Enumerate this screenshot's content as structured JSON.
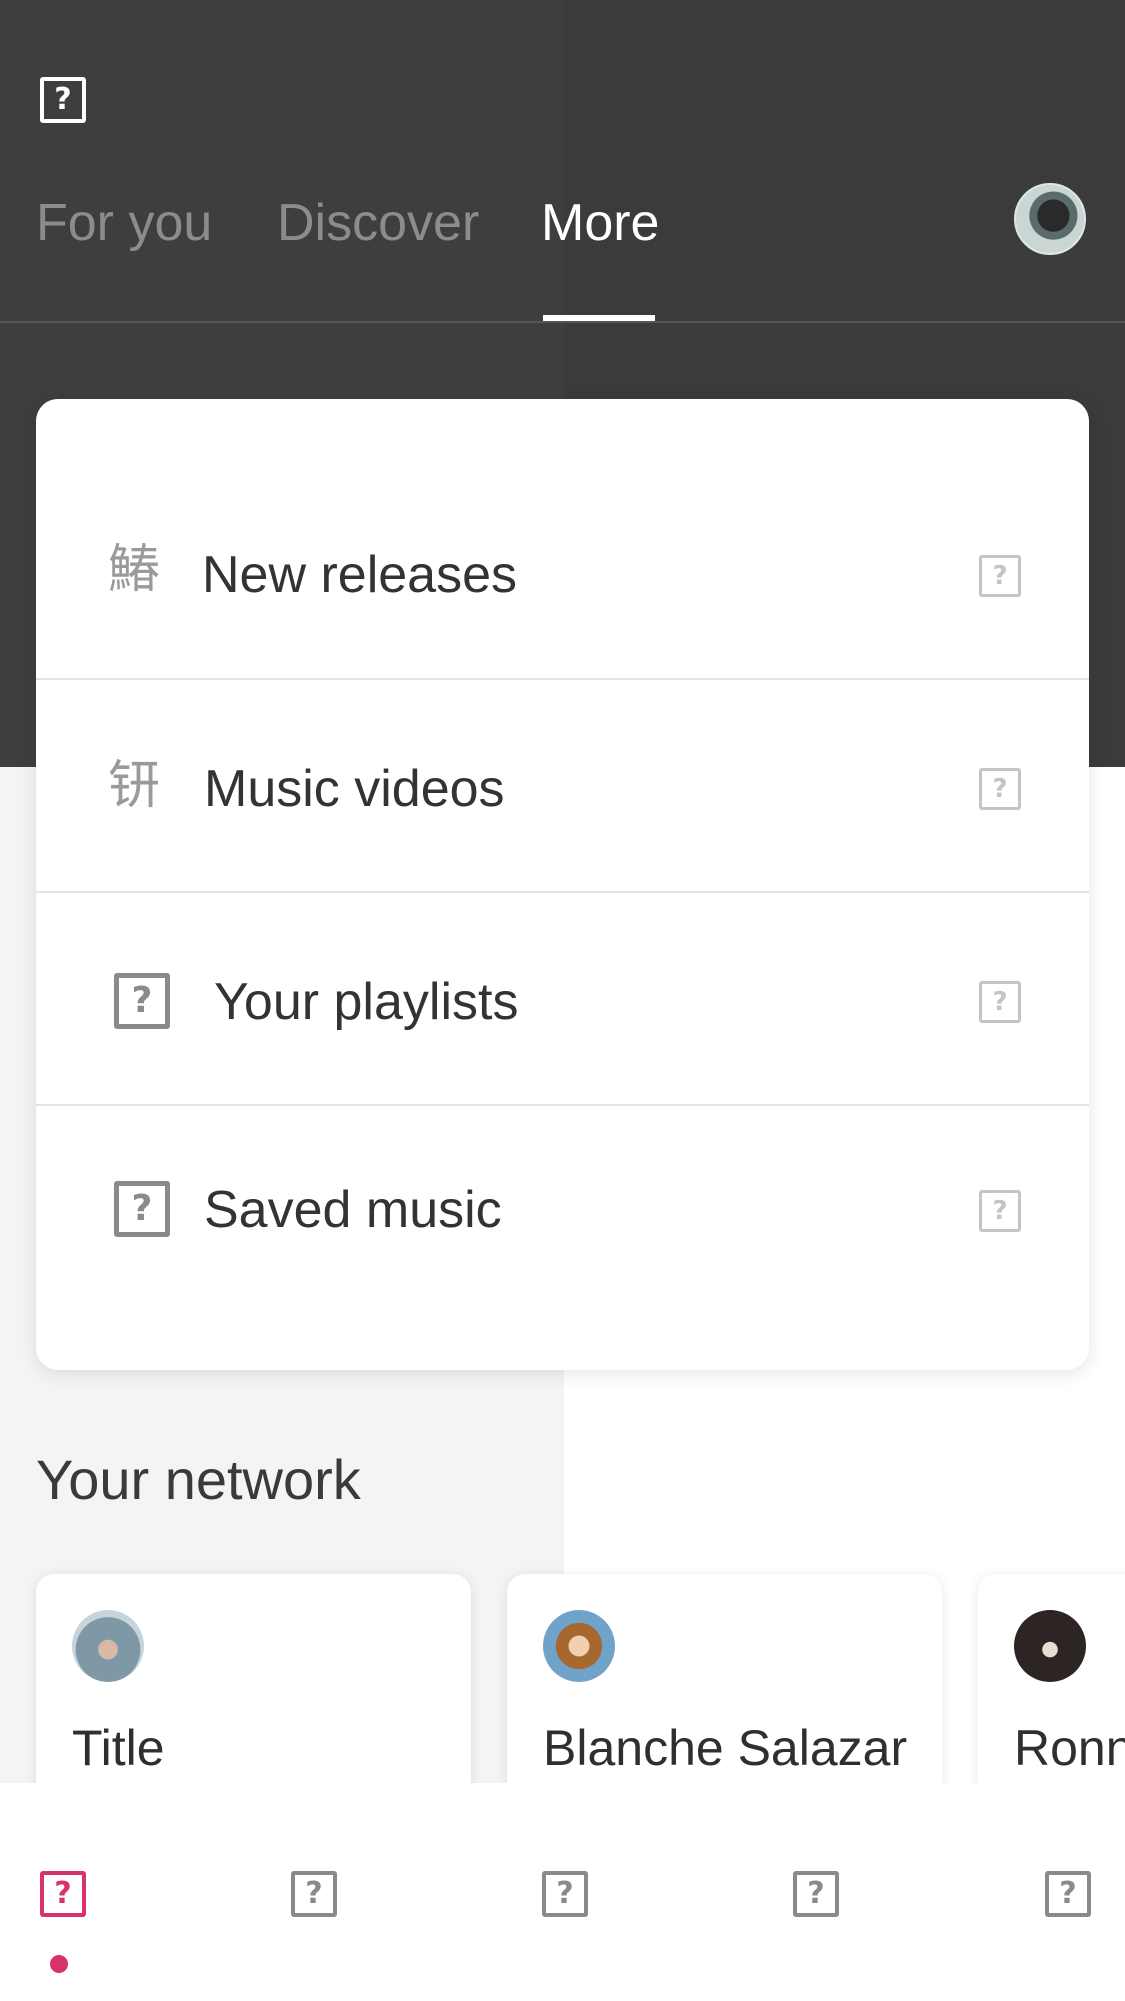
{
  "header": {
    "menu_icon": "menu-icon",
    "tabs": [
      {
        "label": "For you",
        "active": false
      },
      {
        "label": "Discover",
        "active": false
      },
      {
        "label": "More",
        "active": true
      }
    ],
    "profile_avatar": "profile-avatar"
  },
  "more_menu": {
    "items": [
      {
        "label": "New releases",
        "icon": "鰆",
        "chevron": "chevron-right-icon"
      },
      {
        "label": "Music videos",
        "icon": "钘",
        "chevron": "chevron-right-icon"
      },
      {
        "label": "Your playlists",
        "icon": "playlist-icon",
        "chevron": "chevron-right-icon"
      },
      {
        "label": "Saved music",
        "icon": "saved-icon",
        "chevron": "chevron-right-icon"
      }
    ]
  },
  "network": {
    "title": "Your network",
    "cards": [
      {
        "name": "Title"
      },
      {
        "name": "Blanche Salazar"
      },
      {
        "name": "Ronn"
      }
    ]
  },
  "bottom_nav": {
    "items": [
      "home-icon",
      "search-icon",
      "library-icon",
      "activity-icon",
      "settings-icon"
    ],
    "active_index": 0
  },
  "colors": {
    "header_bg": "#3e3e3e",
    "accent": "#d6336c",
    "text_primary": "#333333",
    "tab_inactive": "#8c8c8c"
  }
}
